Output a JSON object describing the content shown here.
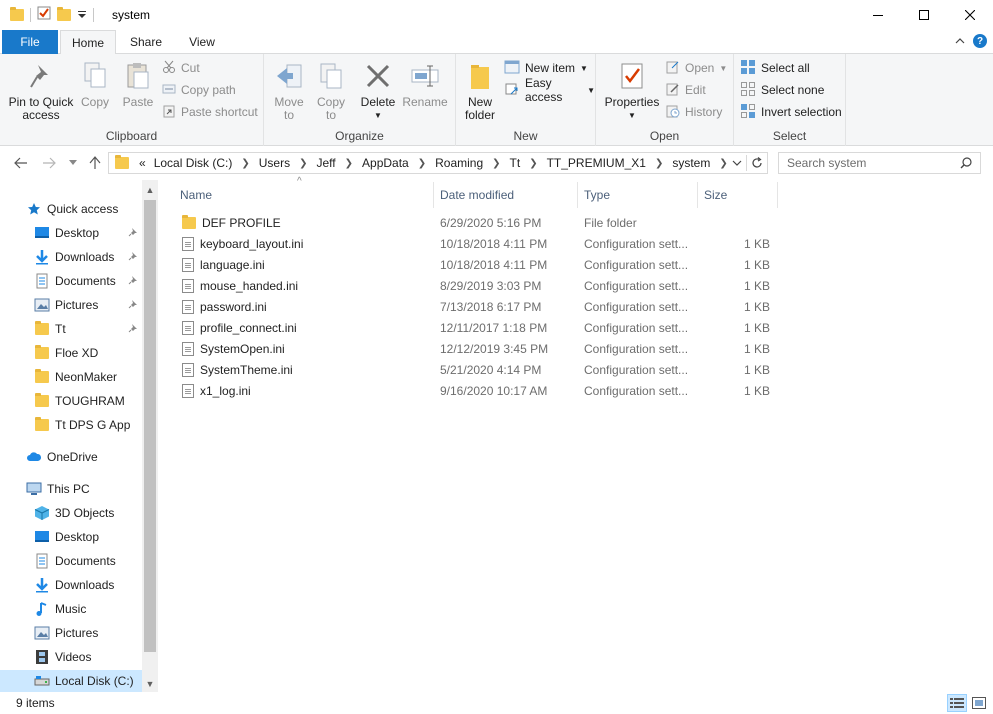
{
  "window": {
    "title": "system"
  },
  "tabs": {
    "file": "File",
    "home": "Home",
    "share": "Share",
    "view": "View"
  },
  "ribbon": {
    "clipboard": {
      "label": "Clipboard",
      "pin_line1": "Pin to Quick",
      "pin_line2": "access",
      "copy": "Copy",
      "paste": "Paste",
      "cut": "Cut",
      "copy_path": "Copy path",
      "paste_shortcut": "Paste shortcut"
    },
    "organize": {
      "label": "Organize",
      "move_line1": "Move",
      "move_line2": "to",
      "copy_line1": "Copy",
      "copy_line2": "to",
      "delete": "Delete",
      "rename": "Rename"
    },
    "new": {
      "label": "New",
      "folder_line1": "New",
      "folder_line2": "folder",
      "new_item": "New item",
      "easy_access": "Easy access"
    },
    "open": {
      "label": "Open",
      "properties": "Properties",
      "open": "Open",
      "edit": "Edit",
      "history": "History"
    },
    "select": {
      "label": "Select",
      "select_all": "Select all",
      "select_none": "Select none",
      "invert": "Invert selection"
    }
  },
  "address": {
    "overflow": "«",
    "crumbs": [
      "Local Disk (C:)",
      "Users",
      "Jeff",
      "AppData",
      "Roaming",
      "Tt",
      "TT_PREMIUM_X1",
      "system"
    ]
  },
  "search": {
    "placeholder": "Search system"
  },
  "nav": {
    "quick_access": "Quick access",
    "qa_items": [
      "Desktop",
      "Downloads",
      "Documents",
      "Pictures",
      "Tt",
      "Floe XD",
      "NeonMaker",
      "TOUGHRAM",
      "Tt DPS G App"
    ],
    "onedrive": "OneDrive",
    "this_pc": "This PC",
    "pc_items": [
      "3D Objects",
      "Desktop",
      "Documents",
      "Downloads",
      "Music",
      "Pictures",
      "Videos",
      "Local Disk (C:)"
    ]
  },
  "columns": {
    "name": "Name",
    "date": "Date modified",
    "type": "Type",
    "size": "Size"
  },
  "files": [
    {
      "name": "DEF PROFILE",
      "date": "6/29/2020 5:16 PM",
      "type": "File folder",
      "size": ""
    },
    {
      "name": "keyboard_layout.ini",
      "date": "10/18/2018 4:11 PM",
      "type": "Configuration sett...",
      "size": "1 KB"
    },
    {
      "name": "language.ini",
      "date": "10/18/2018 4:11 PM",
      "type": "Configuration sett...",
      "size": "1 KB"
    },
    {
      "name": "mouse_handed.ini",
      "date": "8/29/2019 3:03 PM",
      "type": "Configuration sett...",
      "size": "1 KB"
    },
    {
      "name": "password.ini",
      "date": "7/13/2018 6:17 PM",
      "type": "Configuration sett...",
      "size": "1 KB"
    },
    {
      "name": "profile_connect.ini",
      "date": "12/11/2017 1:18 PM",
      "type": "Configuration sett...",
      "size": "1 KB"
    },
    {
      "name": "SystemOpen.ini",
      "date": "12/12/2019 3:45 PM",
      "type": "Configuration sett...",
      "size": "1 KB"
    },
    {
      "name": "SystemTheme.ini",
      "date": "5/21/2020 4:14 PM",
      "type": "Configuration sett...",
      "size": "1 KB"
    },
    {
      "name": "x1_log.ini",
      "date": "9/16/2020 10:17 AM",
      "type": "Configuration sett...",
      "size": "1 KB"
    }
  ],
  "status": {
    "count": "9 items"
  },
  "colors": {
    "accent": "#1979ca",
    "selected": "#cce8ff",
    "folder": "#f6c94d",
    "header_text": "#4c607a"
  }
}
